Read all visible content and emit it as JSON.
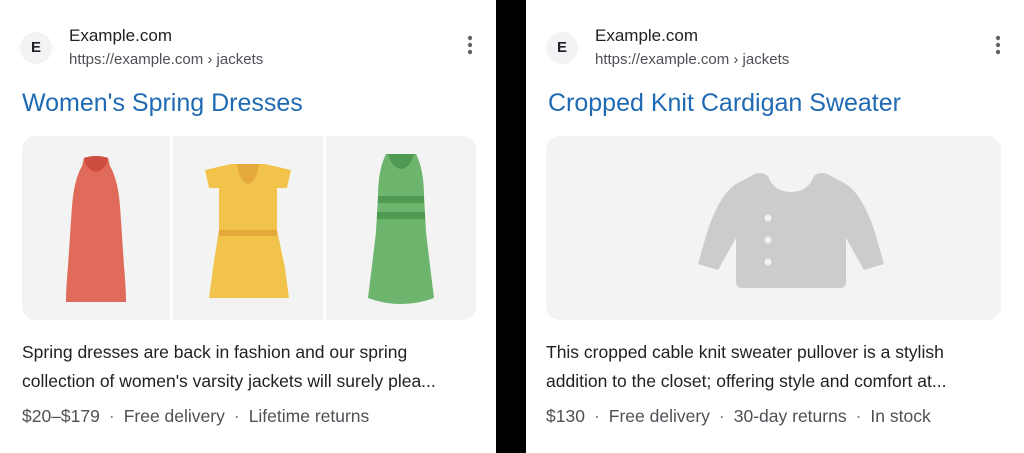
{
  "cards": [
    {
      "favicon_letter": "E",
      "site_name": "Example.com",
      "site_url": "https://example.com › jackets",
      "title": "Women's Spring Dresses",
      "images": [
        "red-dress-icon",
        "yellow-dress-icon",
        "green-dress-icon"
      ],
      "snippet_line1": "Spring dresses are back in fashion and our spring",
      "snippet_line2": "collection of women's varsity jackets will surely plea...",
      "meta": [
        "$20–$179",
        "Free delivery",
        "Lifetime returns"
      ],
      "colors": {
        "red_dress": "#e06b5a",
        "yellow_dress": "#f2c34a",
        "green_dress": "#6db46d"
      }
    },
    {
      "favicon_letter": "E",
      "site_name": "Example.com",
      "site_url": "https://example.com › jackets",
      "title": "Cropped Knit Cardigan Sweater",
      "images": [
        "cardigan-placeholder-icon"
      ],
      "snippet_line1": "This cropped cable knit sweater pullover is a stylish",
      "snippet_line2": "addition to the closet; offering style and comfort at...",
      "meta": [
        "$130",
        "Free delivery",
        "30-day returns",
        "In stock"
      ],
      "colors": {
        "cardigan": "#cccccc"
      }
    }
  ],
  "theme": {
    "title_link": "#1f6ab3",
    "background": "#000000",
    "card": "#ffffff"
  }
}
